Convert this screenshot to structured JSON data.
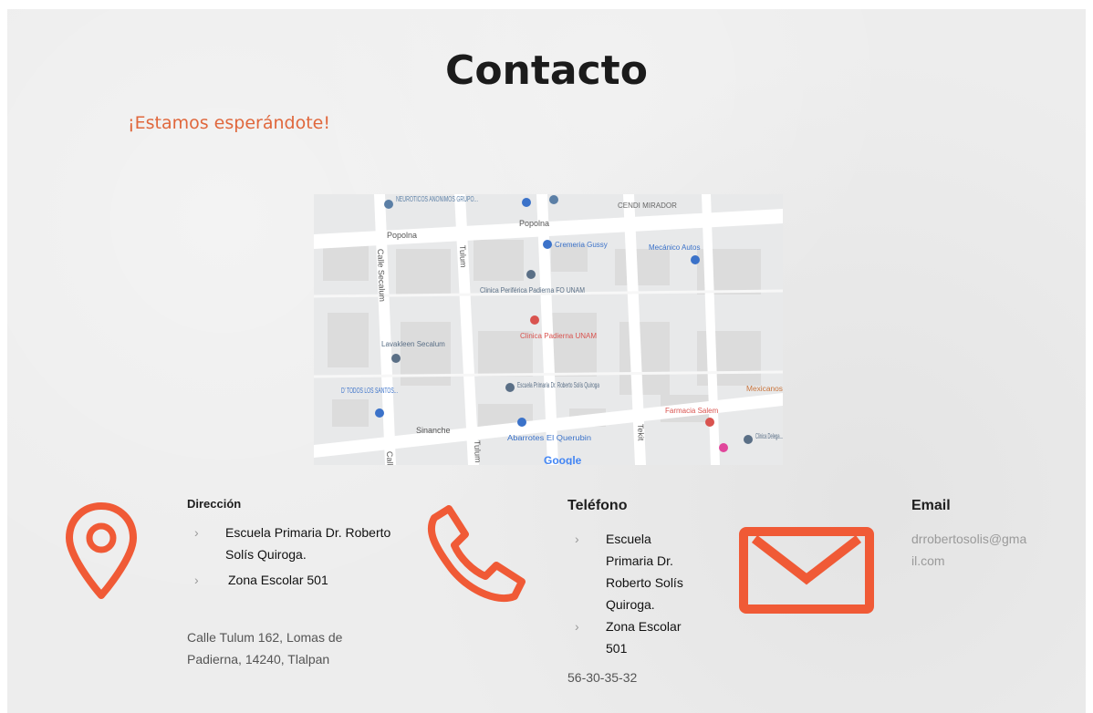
{
  "page": {
    "title": "Contacto",
    "subtitle": "¡Estamos esperándote!"
  },
  "map": {
    "streets": [
      "Popolna",
      "Popolna",
      "Calle Secalum",
      "Tulum",
      "Tulum",
      "Sinanche",
      "Tekit",
      "Calle"
    ],
    "places": [
      {
        "label": "NEUROTICOS ANONIMOS GRUPO...",
        "color": "#5b7fa6"
      },
      {
        "label": "CENDI MIRADOR",
        "color": "#666666"
      },
      {
        "label": "Cremeria Gussy",
        "color": "#3b72c9"
      },
      {
        "label": "Mecánico Autos",
        "color": "#3b72c9"
      },
      {
        "label": "Clinica Periférica Padierna FO UNAM",
        "color": "#5a6f86"
      },
      {
        "label": "Clinica Padierna UNAM",
        "color": "#d9534f"
      },
      {
        "label": "Lavakleen Secalum",
        "color": "#5a6f86"
      },
      {
        "label": "D' TODOS LOS SANTOS...",
        "color": "#3b72c9"
      },
      {
        "label": "Escuela Primaria Dr. Roberto Solís Quiroga",
        "color": "#5a6f86"
      },
      {
        "label": "Mexicanos",
        "color": "#c9743c"
      },
      {
        "label": "Farmacia Salem",
        "color": "#d9534f"
      },
      {
        "label": "Abarrotes El Querubin",
        "color": "#3b72c9"
      },
      {
        "label": "Clinica Delega...",
        "color": "#5a6f86"
      }
    ],
    "logo": "Google"
  },
  "address": {
    "heading": "Dirección",
    "items": [
      "Escuela Primaria Dr. Roberto Solís Quiroga.",
      "Zona Escolar 501"
    ],
    "line1": "Calle Tulum 162, Lomas de",
    "line2": "Padierna, 14240, Tlalpan"
  },
  "phone": {
    "heading": "Teléfono",
    "item1_line1": "Escuela",
    "item1_line2": "Primaria Dr.",
    "item1_line3": "Roberto Solís",
    "item1_line4": "Quiroga.",
    "item2_line1": "Zona Escolar",
    "item2_line2": "501",
    "number": "56-30-35-32"
  },
  "email": {
    "heading": "Email",
    "line1": "drrobertosolis@gma",
    "line2": "il.com"
  },
  "icons": {
    "address": "location-pin-icon",
    "phone": "phone-icon",
    "email": "envelope-icon",
    "chevron": "›"
  },
  "colors": {
    "accent": "#f05a36",
    "subtitle": "#e0673c",
    "background": "#ededed"
  }
}
